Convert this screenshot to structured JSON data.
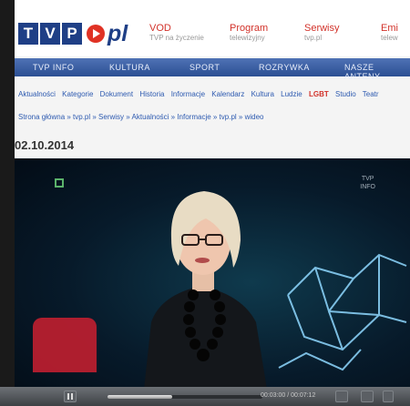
{
  "header": {
    "logo_box_letters": [
      "T",
      "V",
      "P"
    ],
    "logo_suffix": "pl",
    "links": [
      {
        "title": "VOD",
        "subtitle": "TVP na życzenie"
      },
      {
        "title": "Program",
        "subtitle": "telewizyjny"
      },
      {
        "title": "Serwisy",
        "subtitle": "tvp.pl"
      },
      {
        "title": "Emi",
        "subtitle": "telew"
      }
    ]
  },
  "nav": {
    "items": [
      "TVP INFO",
      "KULTURA",
      "SPORT",
      "ROZRYWKA",
      "NASZE ANTENY"
    ]
  },
  "sublinks": {
    "items": [
      "Aktualności",
      "Kategorie",
      "Dokument",
      "Historia",
      "Informacje",
      "Kalendarz",
      "Kultura",
      "Ludzie",
      "LGBT",
      "Studio",
      "Teatr"
    ],
    "active_index": 8
  },
  "breadcrumb": "Strona główna » tvp.pl » Serwisy » Aktualności » Informacje » tvp.pl » wideo",
  "date": "02.10.2014",
  "video": {
    "channel_mark": "TVP\nINFO",
    "player": {
      "progress": 0.42,
      "time_label": "00:03:00 / 00:07:12"
    }
  },
  "colors": {
    "brand_blue": "#1f3f86",
    "brand_red": "#e03224",
    "nav_bg": "#3a5fa6",
    "link": "#2d5ab0",
    "active_link": "#d2322a"
  }
}
